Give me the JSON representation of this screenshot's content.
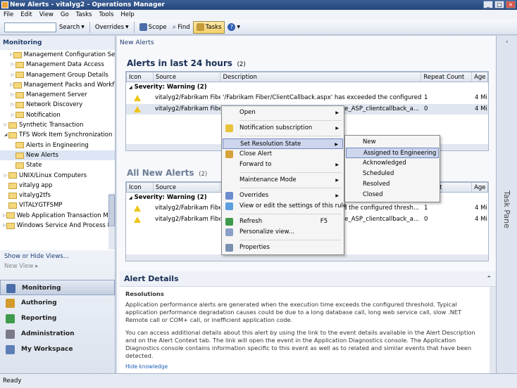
{
  "window": {
    "title": "New Alerts - vitalyg2 - Operations Manager"
  },
  "menu": [
    "File",
    "Edit",
    "View",
    "Go",
    "Tasks",
    "Tools",
    "Help"
  ],
  "toolbar": {
    "search_label": "Search",
    "overrides_label": "Overrides",
    "scope_label": "Scope",
    "find_label": "Find",
    "tasks_label": "Tasks"
  },
  "left": {
    "header": "Monitoring",
    "tree": [
      {
        "label": "Management Configuration Service",
        "indent": 2,
        "arrow": true
      },
      {
        "label": "Management Data Access",
        "indent": 2,
        "arrow": true
      },
      {
        "label": "Management Group Details",
        "indent": 2,
        "arrow": true
      },
      {
        "label": "Management Packs and Workflows",
        "indent": 2,
        "arrow": true
      },
      {
        "label": "Management Server",
        "indent": 2,
        "arrow": true
      },
      {
        "label": "Network Discovery",
        "indent": 2,
        "arrow": true
      },
      {
        "label": "Notification",
        "indent": 2,
        "arrow": true
      },
      {
        "label": "Synthetic Transaction",
        "indent": 1,
        "arrow": true
      },
      {
        "label": "TFS Work Item Synchronization",
        "indent": 1,
        "arrow": true,
        "open": true
      },
      {
        "label": "Alerts in Engineering",
        "indent": 2,
        "arrow": false
      },
      {
        "label": "New Alerts",
        "indent": 2,
        "arrow": false,
        "selected": true
      },
      {
        "label": "State",
        "indent": 2,
        "arrow": false
      },
      {
        "label": "UNIX/Linux Computers",
        "indent": 1,
        "arrow": true
      },
      {
        "label": "vitalyg app",
        "indent": 1,
        "arrow": false
      },
      {
        "label": "vitalyg2tfs",
        "indent": 1,
        "arrow": false
      },
      {
        "label": "VITALYGTFSMP",
        "indent": 1,
        "arrow": false
      },
      {
        "label": "Web Application Transaction Monitoring",
        "indent": 1,
        "arrow": true
      },
      {
        "label": "Windows Service And Process Monitoring",
        "indent": 1,
        "arrow": true
      }
    ],
    "show_hide": "Show or Hide Views...",
    "new_view": "New View ▸",
    "wunderbar": [
      {
        "label": "Monitoring",
        "active": true,
        "color": "#4b6ea9"
      },
      {
        "label": "Authoring",
        "active": false,
        "color": "#d59a2c"
      },
      {
        "label": "Reporting",
        "active": false,
        "color": "#3f9a4b"
      },
      {
        "label": "Administration",
        "active": false,
        "color": "#7a7a8a"
      },
      {
        "label": "My Workspace",
        "active": false,
        "color": "#5c7fb8"
      }
    ]
  },
  "breadcrumb": "New Alerts",
  "grid1": {
    "title": "Alerts in last 24 hours",
    "count": "(2)",
    "columns": [
      "Icon",
      "Source",
      "Description",
      "Repeat Count",
      "Age"
    ],
    "group": "Severity: Warning (2)",
    "rows": [
      {
        "source": "vitalyg2/Fabrikam Fiber",
        "description": "'/Fabrikam Fiber/ClientCallback.aspx' has exceeded the configured thresh...",
        "repeat": "1",
        "age": "4 Mi"
      },
      {
        "source": "vitalyg2/Fabrikam Fiber",
        "description": "Create_ASP_clientcallback_a...",
        "repeat": "0",
        "age": "4 Mi"
      }
    ]
  },
  "grid2": {
    "title": "All New Alerts",
    "count": "(2)",
    "columns": [
      "Icon",
      "Source",
      "Count",
      "Age"
    ],
    "group": "Severity: Warning (2)",
    "rows": [
      {
        "source": "vitalyg2/Fabrikam Fiber",
        "description": "exceeded the configured thresh...",
        "repeat": "1",
        "age": "4 Mi"
      },
      {
        "source": "vitalyg2/Fabrikam Fiber",
        "description": "Create_ASP_clientcallback_a...",
        "repeat": "0",
        "age": "4 Mi"
      }
    ]
  },
  "context_menu": [
    {
      "label": "Open",
      "submenu": true
    },
    {
      "sep": true
    },
    {
      "label": "Notification subscription",
      "submenu": true,
      "icon": "#e8c33b"
    },
    {
      "sep": true
    },
    {
      "label": "Set Resolution State",
      "submenu": true,
      "highlight": true
    },
    {
      "label": "Close Alert",
      "icon": "#d8a23b"
    },
    {
      "label": "Forward to",
      "submenu": true
    },
    {
      "sep": true
    },
    {
      "label": "Maintenance Mode",
      "submenu": true
    },
    {
      "sep": true
    },
    {
      "label": "Overrides",
      "submenu": true,
      "icon": "#6b8ccf"
    },
    {
      "label": "View or edit the settings of this rule",
      "icon": "#5aa0e0"
    },
    {
      "sep": true
    },
    {
      "label": "Refresh",
      "key": "F5",
      "icon": "#3c9a4a"
    },
    {
      "label": "Personalize view...",
      "icon": "#8aa0c8"
    },
    {
      "sep": true
    },
    {
      "label": "Properties",
      "icon": "#7a8fb0"
    }
  ],
  "submenu": [
    {
      "label": "New"
    },
    {
      "label": "Assigned to Engineering",
      "highlight": true
    },
    {
      "label": "Acknowledged"
    },
    {
      "label": "Scheduled"
    },
    {
      "label": "Resolved"
    },
    {
      "label": "Closed"
    }
  ],
  "details": {
    "title": "Alert Details",
    "section": "Resolutions",
    "p1": "Application performance alerts are generated when the execution time exceeds the configured threshold. Typical application performance degradation causes could be due to a long database call, long web service call, slow .NET Remote call or COM+ call, or inefficient application code.",
    "p2": "You can access additional details about this alert by using the link to the event details available in the Alert Description and on the Alert Context tab. The link will open the event in the Application Diagnostics console. The Application Diagnostics console contains information specific to this event as well as to related and similar events that have been detected.",
    "link": "Hide knowledge"
  },
  "taskpane": "Task Pane",
  "status": "Ready"
}
